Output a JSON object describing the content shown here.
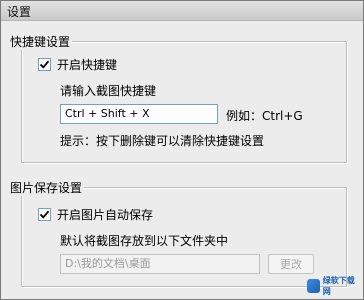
{
  "window": {
    "title": "设置"
  },
  "shortcut": {
    "group_title": "快捷键设置",
    "enable_label": "开启快捷键",
    "enable_checked": true,
    "prompt": "请输入截图快捷键",
    "value": "Ctrl + Shift + X",
    "example": "例如：Ctrl+G",
    "tip": "提示：按下删除键可以清除快捷键设置"
  },
  "image_save": {
    "group_title": "图片保存设置",
    "enable_label": "开启图片自动保存",
    "enable_checked": true,
    "desc": "默认将截图存放到以下文件夹中",
    "path": "D:\\我的文档\\桌面",
    "change_label": "更改"
  },
  "watermark": {
    "text": "绿软下载网"
  },
  "colors": {
    "accent": "#1d5fb0"
  }
}
